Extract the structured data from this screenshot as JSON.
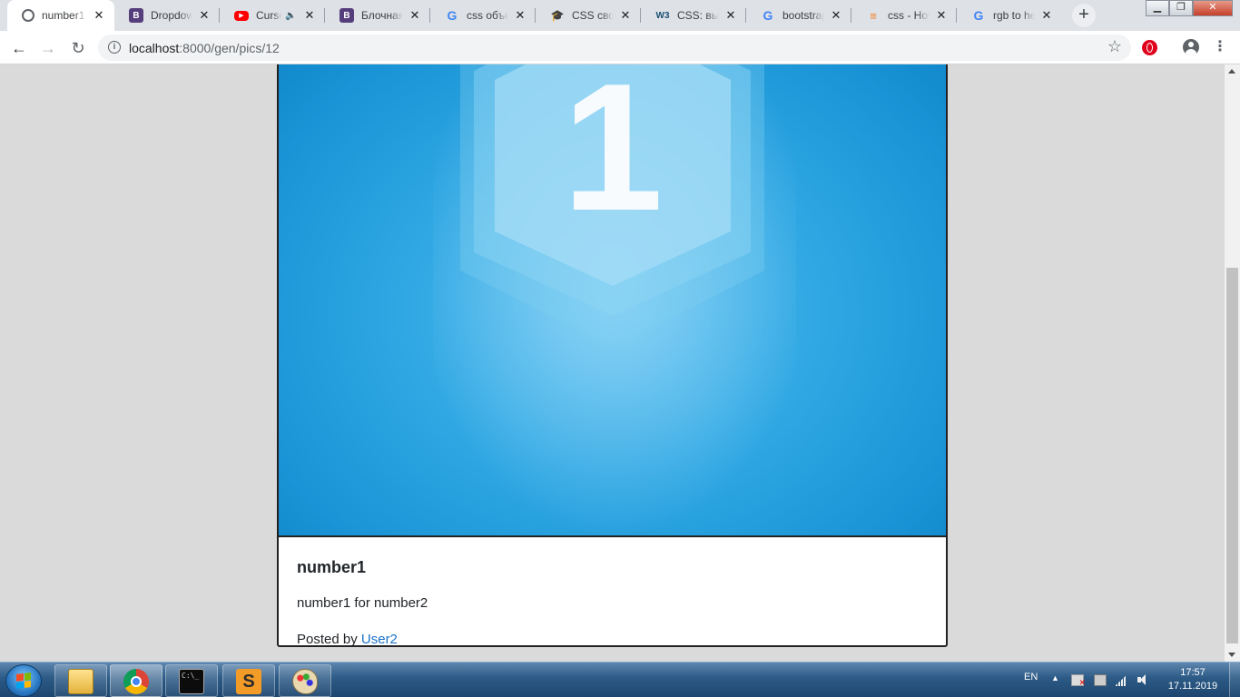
{
  "browser": {
    "tabs": [
      {
        "title": "number1",
        "favicon": "globe-icon",
        "active": true
      },
      {
        "title": "Dropdowns",
        "favicon": "bootstrap-icon",
        "active": false
      },
      {
        "title": "Curse",
        "favicon": "youtube-icon",
        "active": false,
        "audio": true
      },
      {
        "title": "Блочная",
        "favicon": "bootstrap-icon",
        "active": false
      },
      {
        "title": "css объек",
        "favicon": "google-icon",
        "active": false
      },
      {
        "title": "CSS свой",
        "favicon": "graduation-cap-icon",
        "active": false
      },
      {
        "title": "CSS: выр",
        "favicon": "w3-icon",
        "active": false
      },
      {
        "title": "bootstrap",
        "favicon": "google-icon",
        "active": false
      },
      {
        "title": "css - How",
        "favicon": "stackoverflow-icon",
        "active": false
      },
      {
        "title": "rgb to he",
        "favicon": "google-icon",
        "active": false
      }
    ],
    "address": {
      "host": "localhost",
      "path": ":8000/gen/pics/12"
    }
  },
  "page": {
    "card": {
      "image_label": "1",
      "title": "number1",
      "text": "number1 for number2",
      "posted_by_prefix": "Posted by",
      "author": "User2"
    }
  },
  "taskbar": {
    "apps": [
      "file-explorer-icon",
      "chrome-icon",
      "command-prompt-icon",
      "sublime-text-icon",
      "paint-icon"
    ],
    "cmd_glyph": "C:\\_",
    "sublime_glyph": "S",
    "language": "EN",
    "time": "17:57",
    "date": "17.11.2019"
  },
  "colors": {
    "link": "#1a73c8",
    "image_blue": "#1a94d6",
    "page_background": "#dadada"
  }
}
